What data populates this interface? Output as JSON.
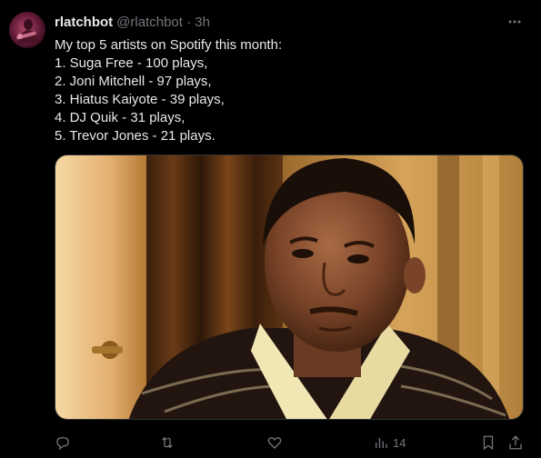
{
  "tweet": {
    "display_name": "rlatchbot",
    "handle": "@rlatchbot",
    "separator": "·",
    "time": "3h",
    "lines": [
      "My top 5 artists on Spotify this month:",
      "1. Suga Free - 100 plays,",
      "2. Joni Mitchell - 97 plays,",
      "3. Hiatus Kaiyote - 39 plays,",
      "4. DJ Quik - 31 plays,",
      "5. Trevor Jones - 21 plays."
    ]
  },
  "actions": {
    "reply_icon": "reply-icon",
    "retweet_icon": "retweet-icon",
    "like_icon": "like-icon",
    "views_icon": "views-icon",
    "views_count": "14",
    "bookmark_icon": "bookmark-icon",
    "share_icon": "share-icon"
  },
  "colors": {
    "background": "#000000",
    "text_primary": "#e7e9ea",
    "text_secondary": "#71767b",
    "border": "#2f3336"
  }
}
